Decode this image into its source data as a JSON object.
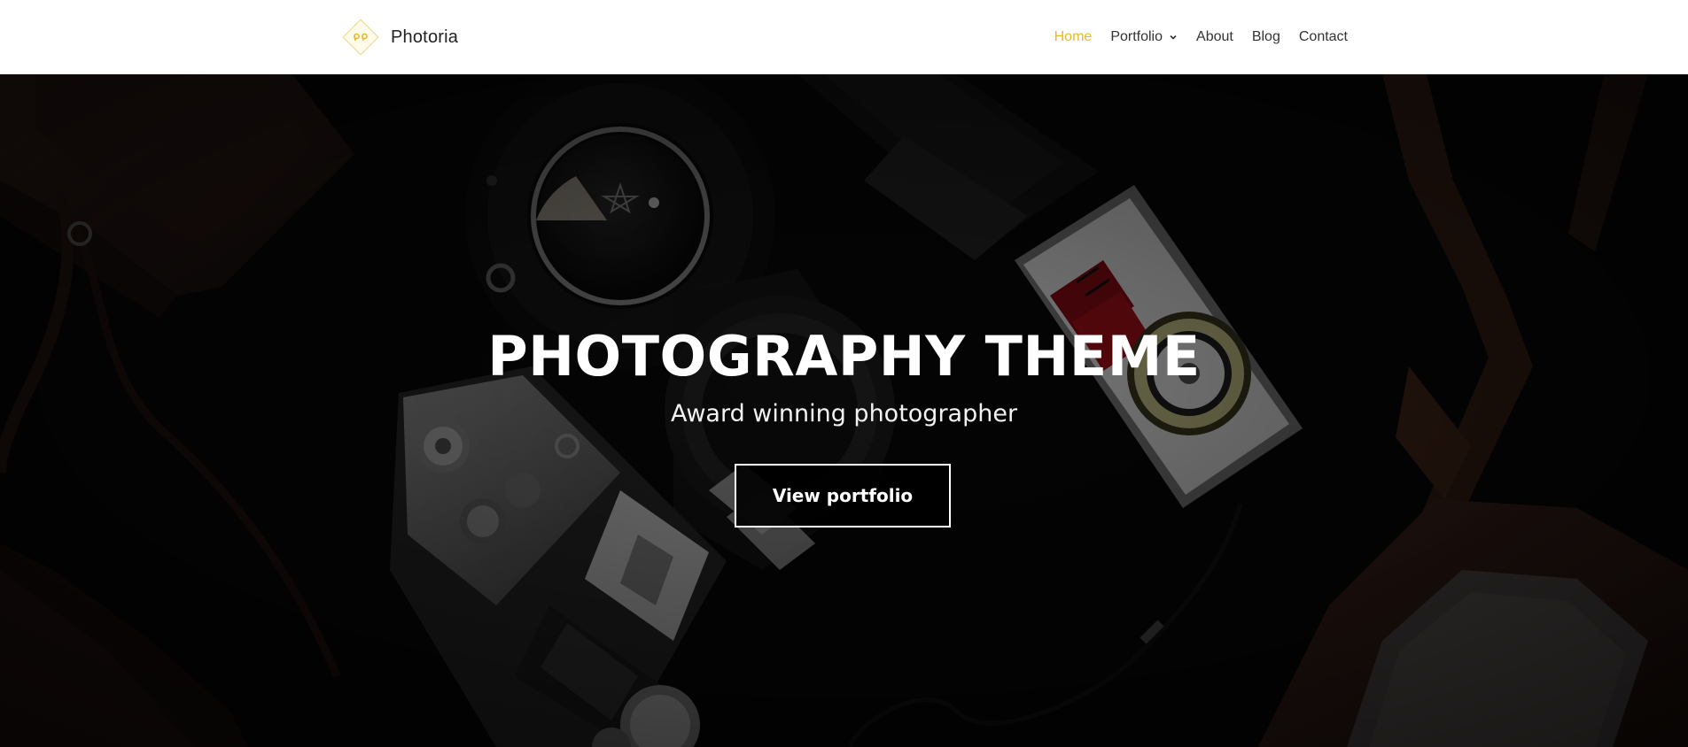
{
  "brand": {
    "name": "Photoria",
    "accent_color": "#e8b923",
    "logo_icon": "diamond-logo-icon"
  },
  "nav": {
    "items": [
      {
        "label": "Home",
        "active": true
      },
      {
        "label": "Portfolio",
        "has_dropdown": true,
        "dropdown_icon": "chevron-down-icon"
      },
      {
        "label": "About"
      },
      {
        "label": "Blog"
      },
      {
        "label": "Contact"
      }
    ]
  },
  "hero": {
    "title": "PHOTOGRAPHY THEME",
    "subtitle": "Award winning photographer",
    "cta_label": "View portfolio"
  }
}
